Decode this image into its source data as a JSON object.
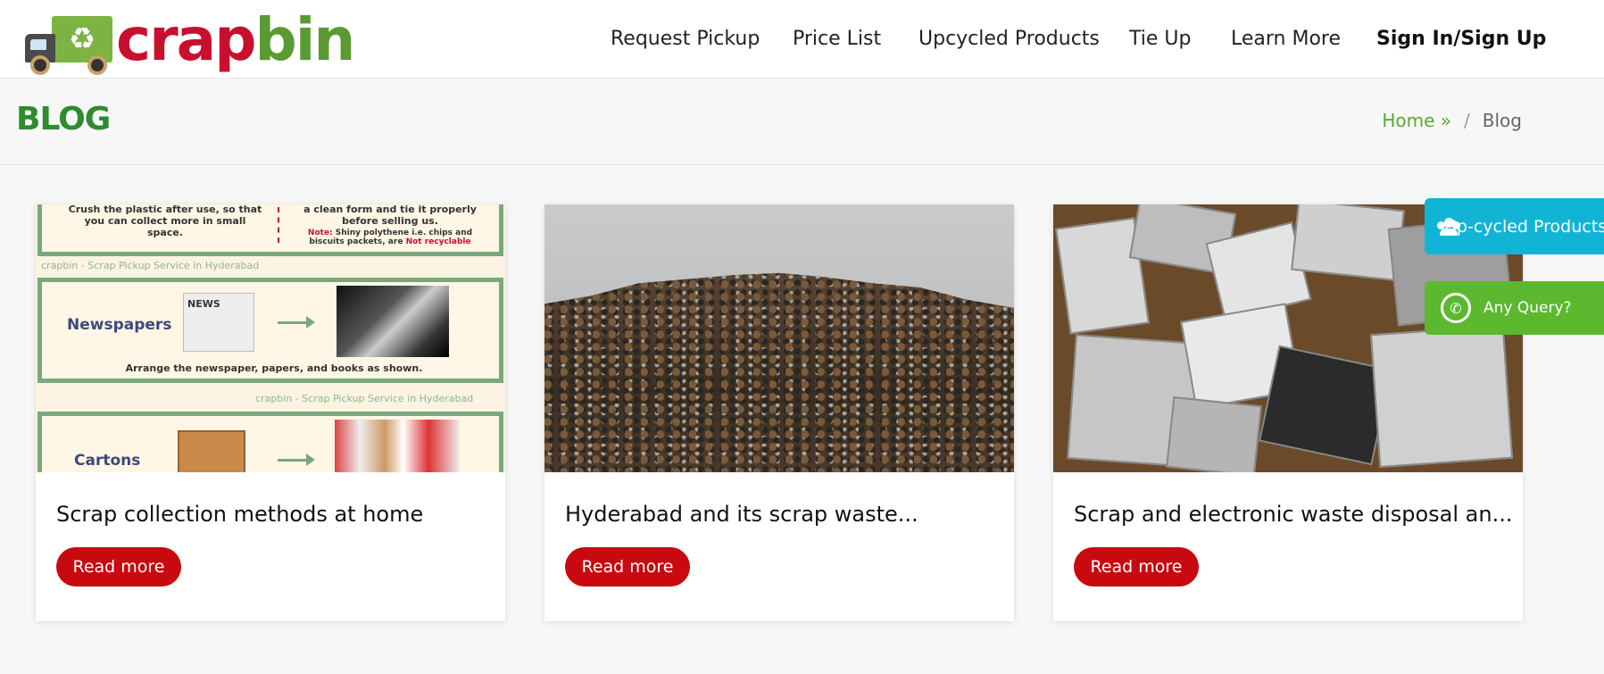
{
  "brand": {
    "name_part1": "crap",
    "name_part2": "bin",
    "truck_symbol": "♻"
  },
  "nav": {
    "items": [
      "Request Pickup",
      "Price List",
      "Upcycled Products",
      "Tie Up",
      "Learn More"
    ],
    "signin": "Sign In/Sign Up"
  },
  "page": {
    "title": "BLOG",
    "breadcrumb": {
      "home": "Home »",
      "separator": "/",
      "current": "Blog"
    }
  },
  "posts": [
    {
      "title": "Scrap collection methods at home",
      "read_more": "Read more",
      "image": {
        "top_left_text": "Crush the plastic after use, so that you can collect more in small space.",
        "top_right_text": "a clean form and tie it properly before selling us.",
        "note_label": "Note:",
        "note_text": "Shiny polythene i.e. chips and biscuits packets, are",
        "note_emph": "Not recyclable",
        "brand_tag": "crapbin - Scrap Pickup Service in Hyderabad",
        "newspapers_label": "Newspapers",
        "newspapers_caption": "Arrange the newspaper, papers, and books as shown.",
        "news_mark": "NEWS",
        "cartons_label": "Cartons"
      }
    },
    {
      "title": "Hyderabad and its scrap waste...",
      "read_more": "Read more"
    },
    {
      "title": "Scrap and electronic waste disposal an...",
      "read_more": "Read more"
    }
  ],
  "side": {
    "upcycled": "Up-cycled Products",
    "query": "Any Query?",
    "whatsapp_icon": "✆"
  },
  "colors": {
    "brand_red": "#c8102e",
    "brand_green": "#5a9a32",
    "title_green": "#2e8b2e",
    "button_red": "#c8090f",
    "side_cyan": "#12b4d6",
    "side_green": "#5cb82e"
  }
}
